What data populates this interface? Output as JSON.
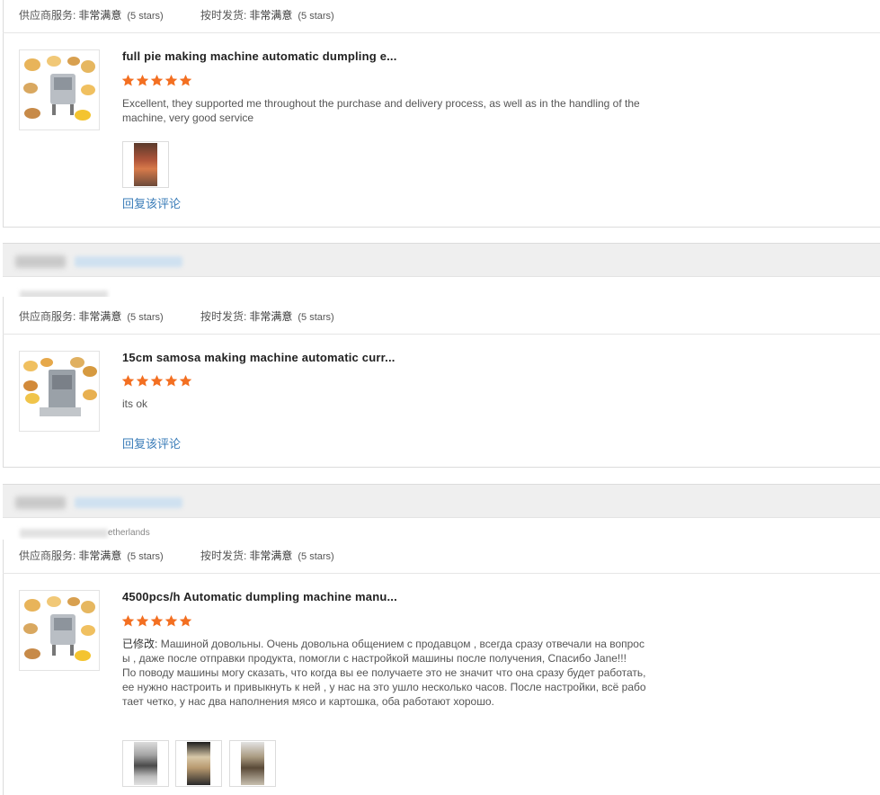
{
  "ratings": {
    "supplier_service_label": "供应商服务:",
    "shipping_label": "按时发货:",
    "very_satisfied": "非常满意",
    "five_stars": "(5 stars)"
  },
  "reply_label": "回复该评论",
  "reviews": [
    {
      "product_title": "full pie making machine automatic dumpling e...",
      "rating": 5,
      "text": "Excellent, they supported me throughout the purchase and delivery process, as well as in the handling of the machine, very good service",
      "photos": 1
    },
    {
      "product_title": "15cm samosa making machine automatic curr...",
      "rating": 5,
      "text": "its ok",
      "photos": 0
    },
    {
      "country_fragment": "etherlands",
      "product_title": "4500pcs/h Automatic dumpling machine manu...",
      "rating": 5,
      "edited_prefix": "已修改:",
      "text": "Машиной довольны. Очень довольна общением с продавцом , всегда сразу отвечали на вопросы , даже после отправки продукта, помогли с настройкой машины после получения, Спасибо Jane!!!",
      "text2": "По поводу машины могу сказать, что когда вы ее получаете это не значит что она сразу будет работать, ее нужно настроить и привыкнуть к ней , у нас на это ушло несколько часов. После настройки, всё работает четко, у нас два наполнения мясо и картошка, оба работают хорошо.",
      "photos": 3
    }
  ],
  "colors": {
    "star": "#f36f21",
    "link": "#3a7cb8"
  }
}
